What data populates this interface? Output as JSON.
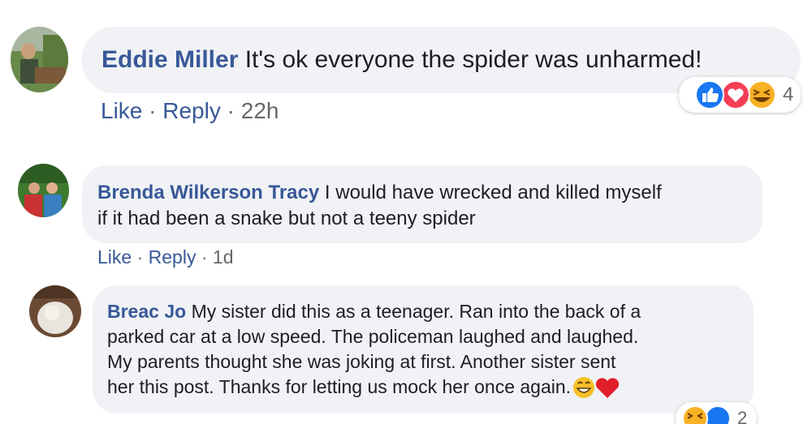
{
  "colors": {
    "author": "#385898",
    "text": "#1c1e21",
    "meta": "#65676b",
    "bubble": "#f0f2f5",
    "like": "#1877f2",
    "love": "#f33e58",
    "haha": "#f7b125"
  },
  "comments": [
    {
      "author": "Eddie Miller",
      "text": "It's ok everyone the spider was unharmed!",
      "like_label": "Like",
      "reply_label": "Reply",
      "separator": "·",
      "time": "22h",
      "reaction_icons": [
        "like-reaction-icon",
        "love-reaction-icon",
        "haha-reaction-icon"
      ],
      "reaction_count": "4"
    },
    {
      "author": "Brenda Wilkerson Tracy",
      "text_line1": "I would have wrecked and killed myself",
      "text_line2": "if it had been a snake but not a teeny spider",
      "like_label": "Like",
      "reply_label": "Reply",
      "separator": "·",
      "time": "1d"
    },
    {
      "author": "Breac Jo",
      "text_line1": "My sister did this as a teenager. Ran into the back of a",
      "text_line2": "parked car at a low speed. The policeman laughed and laughed.",
      "text_line3": "My parents thought she was joking at first. Another sister sent",
      "text_line4": "her this post. Thanks for letting us mock her once again.",
      "emoji_icons": [
        "grinning-face-emoji-icon",
        "red-heart-emoji-icon"
      ],
      "reaction_icons": [
        "haha-reaction-icon",
        "like-reaction-icon"
      ],
      "reaction_count": "2"
    }
  ]
}
